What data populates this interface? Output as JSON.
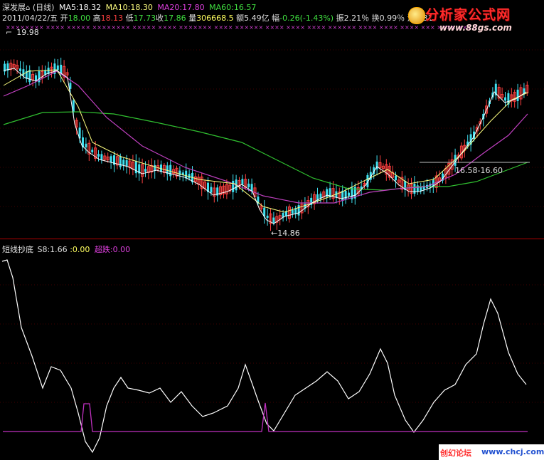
{
  "header": {
    "stock_name": "深发展",
    "period": "(日线)",
    "ma5": "MA5:18.32",
    "ma10": "MA10:18.30",
    "ma20": "MA20:17.80",
    "ma60": "MA60:16.57",
    "date": "2011/04/22/五",
    "open_label": "开",
    "open_value": "18.00",
    "high_label": "高",
    "high_value": "18.13",
    "low_label": "低",
    "low_value": "17.73",
    "close_label": "收",
    "close_value": "17.86",
    "vol_label": "量",
    "vol_value": "306668.5",
    "amt_label": "额",
    "amt_value": "5.49亿",
    "chg_label": "幅",
    "chg_value": "-0.26(-1.43%)",
    "amp_label": "振",
    "amp_value": "2.21％",
    "turn_label": "换",
    "turn_value": "0.99％",
    "float_label": "流通",
    "float_value": "31"
  },
  "price_labels": {
    "high_marker": "19.98",
    "low_marker": "14.86",
    "range_marker": "16.58-16.60"
  },
  "indicator": {
    "name": "短线抄底",
    "s8": "S8:1.66",
    "val": ":0.00",
    "oversold": "超跌:0.00"
  },
  "logo": {
    "main": "分析家公式网",
    "url": "www.88gs.com"
  },
  "watermark": {
    "left": "创幻论坛",
    "right": "www.chcj.com"
  },
  "colors": {
    "background": "#000000",
    "up_candle": "#ff4040",
    "down_candle": "#40e0f0",
    "ma5": "#ffffff",
    "ma10": "#ffff80",
    "ma20": "#c040c0",
    "ma60": "#30c030",
    "indicator_line": "#ffffff",
    "oversold_line": "#c030c0"
  },
  "chart_data": {
    "type": "line",
    "title": "深发展 (日线)",
    "price_range": [
      14.86,
      19.98
    ],
    "series": [
      {
        "name": "MA5",
        "values": [
          18.32
        ]
      },
      {
        "name": "MA10",
        "values": [
          18.3
        ]
      },
      {
        "name": "MA20",
        "values": [
          17.8
        ]
      },
      {
        "name": "MA60",
        "values": [
          16.57
        ]
      }
    ],
    "annotations": [
      "19.98",
      "14.86",
      "16.58-16.60"
    ],
    "indicator": {
      "name": "短线抄底",
      "S8": 1.66,
      "超跌": 0.0
    }
  }
}
